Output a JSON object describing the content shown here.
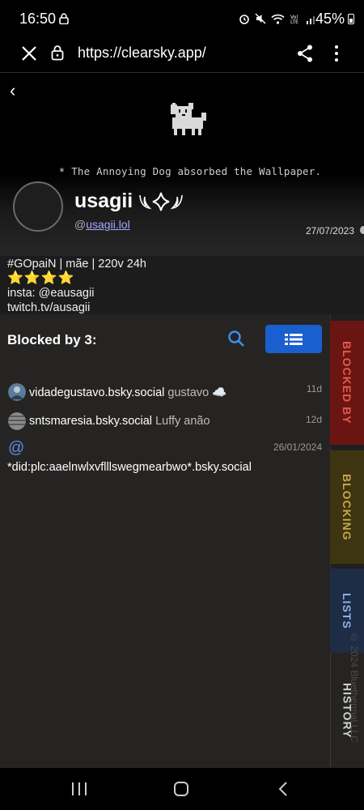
{
  "status_bar": {
    "time": "16:50",
    "battery": "45%"
  },
  "browser": {
    "url": "https://clearsky.app/"
  },
  "profile": {
    "back_label": "‹",
    "wallpaper_caption": "* The Annoying Dog absorbed the Wallpaper.",
    "display_name": "usagii",
    "handle_prefix": "@",
    "handle": "usagii.lol",
    "join_date": "27/07/2023",
    "bio_lines": [
      "#GOpaiN | mãe | 220v 24h",
      "⭐⭐⭐⭐",
      "insta: @eausagii",
      "twitch.tv/ausagii"
    ]
  },
  "panel": {
    "title": "Blocked by 3:",
    "items": [
      {
        "handle": "vidadegustavo.bsky.social",
        "display_name": "gustavo ☁️",
        "time": "11d"
      },
      {
        "handle": "sntsmaresia.bsky.social",
        "display_name": "Luffy anão",
        "time": "12d"
      },
      {
        "at_symbol": "@",
        "did": "*did:plc:aaelnwlxvflllswegmearbwo*.bsky.social",
        "time": "26/01/2024"
      }
    ]
  },
  "side_tabs": {
    "blocked_by": "BLOCKED BY",
    "blocking": "BLOCKING",
    "lists": "LISTS",
    "history": "HISTORY",
    "copyright": "© 2024 Bluethermal LLC"
  },
  "colors": {
    "accent_blue": "#1a5fcf",
    "blocked_by_bg": "#6b1512",
    "blocking_bg": "#3d3512",
    "lists_bg": "#1f2c45"
  }
}
